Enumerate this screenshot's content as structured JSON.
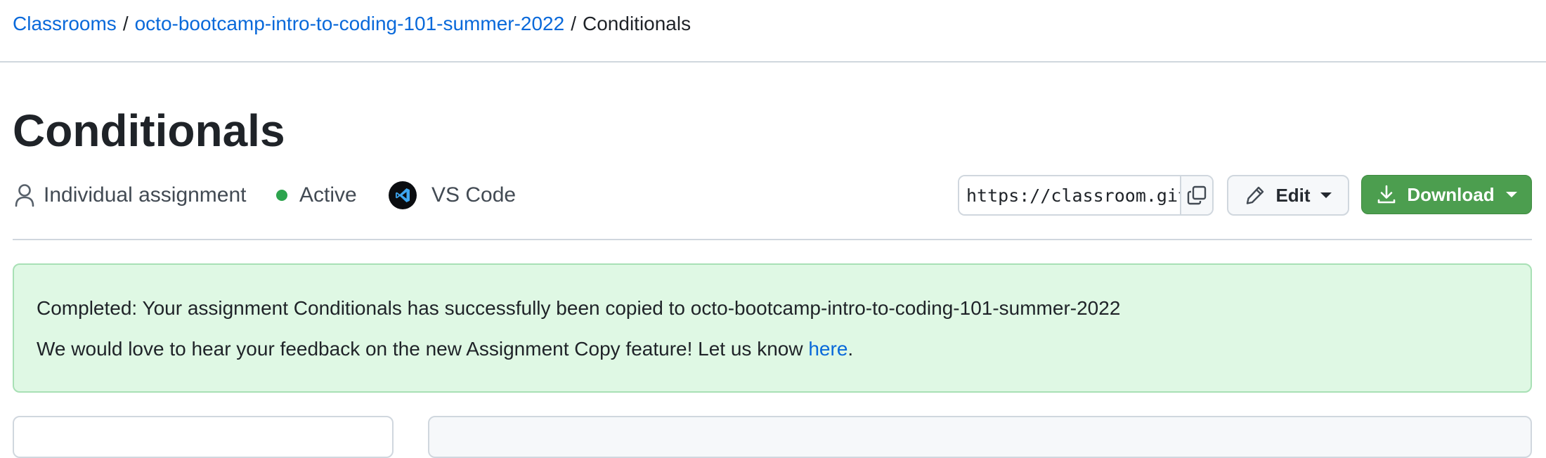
{
  "breadcrumb": {
    "items": [
      {
        "label": "Classrooms"
      },
      {
        "label": "octo-bootcamp-intro-to-coding-101-summer-2022"
      }
    ],
    "separator": "/",
    "current": "Conditionals"
  },
  "page_title": "Conditionals",
  "meta": {
    "assignment_type": "Individual assignment",
    "status": "Active",
    "editor": "VS Code",
    "status_color": "#2da44e"
  },
  "toolbar": {
    "clone_url": "https://classroom.github.com/a/",
    "edit_label": "Edit",
    "download_label": "Download",
    "download_color": "#4c9e4f"
  },
  "flash": {
    "message": "Completed: Your assignment Conditionals has successfully been copied to octo-bootcamp-intro-to-coding-101-summer-2022",
    "feedback_prefix": "We would love to hear your feedback on the new Assignment Copy feature! Let us know ",
    "feedback_link": "here",
    "feedback_suffix": ".",
    "background_color": "#dff8e4"
  },
  "icons": {
    "assignment_type": "person-icon",
    "status": "status-dot-icon",
    "editor": "vscode-icon",
    "copy": "copy-icon",
    "edit": "pencil-icon",
    "download": "download-icon"
  }
}
